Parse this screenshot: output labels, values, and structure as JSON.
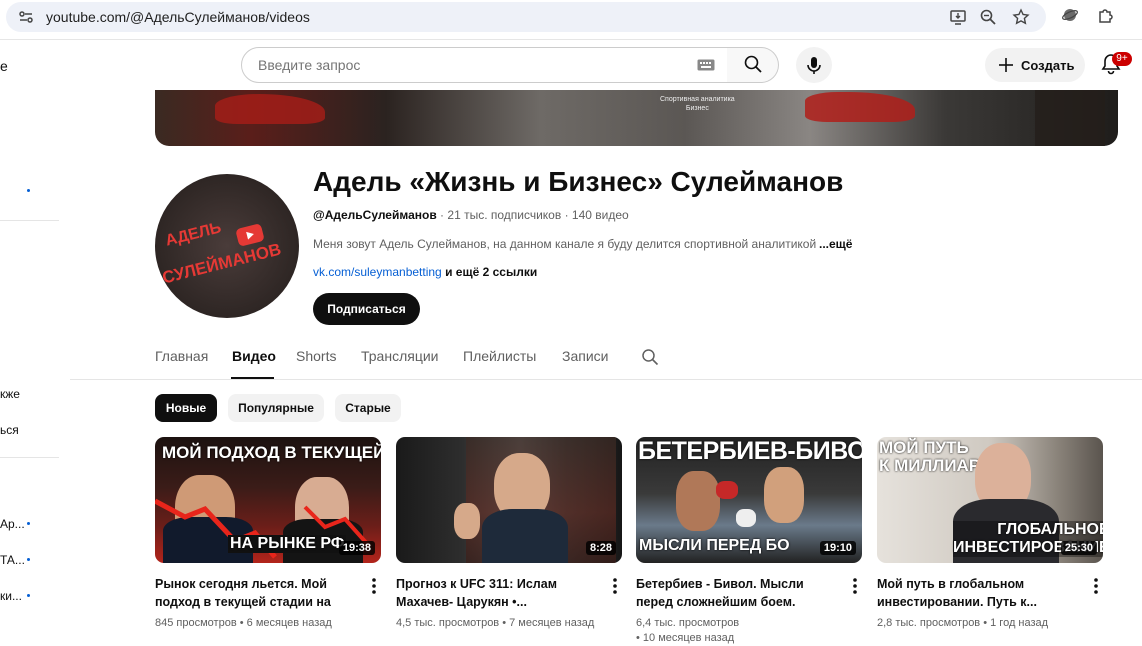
{
  "browser": {
    "url": "youtube.com/@АдельСулейманов/videos"
  },
  "sidebar_fragments": [
    {
      "text": "е"
    },
    {
      "text": "кже"
    },
    {
      "text": "ься"
    },
    {
      "text": "Ар..."
    },
    {
      "text": "ТА..."
    },
    {
      "text": "ки..."
    }
  ],
  "header": {
    "search_placeholder": "Введите запрос",
    "create_label": "Создать",
    "notifications_badge": "9+"
  },
  "banner": {
    "text": "Спортивная аналитика\nБизнес"
  },
  "channel": {
    "avatar_line1": "АДЕЛЬ",
    "avatar_line2": "СУЛЕЙМАНОВ",
    "title": "Адель «Жизнь и Бизнес» Сулейманов",
    "handle": "@АдельСулейманов",
    "subscribers": "21 тыс. подписчиков",
    "videos_count": "140 видео",
    "description": "Меня зовут Адель Сулейманов, на данном канале я буду делится спортивной аналитикой",
    "description_more": "...ещё",
    "link": "vk.com/suleymanbetting",
    "links_more": "и ещё 2 ссылки",
    "subscribe_label": "Подписаться"
  },
  "tabs": [
    {
      "label": "Главная",
      "active": false
    },
    {
      "label": "Видео",
      "active": true
    },
    {
      "label": "Shorts",
      "active": false
    },
    {
      "label": "Трансляции",
      "active": false
    },
    {
      "label": "Плейлисты",
      "active": false
    },
    {
      "label": "Записи",
      "active": false
    }
  ],
  "chips": [
    {
      "label": "Новые",
      "active": true
    },
    {
      "label": "Популярные",
      "active": false
    },
    {
      "label": "Старые",
      "active": false
    }
  ],
  "videos": [
    {
      "thumb_text_top": "МОЙ ПОДХОД В ТЕКУЩЕЙ СТАДИИ",
      "thumb_text_bottom": "НА РЫНКЕ РФ",
      "duration": "19:38",
      "title": "Рынок сегодня льется. Мой подход в текущей стадии на РФ...",
      "views": "845 просмотров",
      "age": "6 месяцев назад"
    },
    {
      "thumb_text_top": "",
      "thumb_text_bottom": "",
      "duration": "8:28",
      "title": "Прогноз к UFC 311: Ислам Махачев- Царукян •...",
      "views": "4,5 тыс. просмотров",
      "age": "7 месяцев назад"
    },
    {
      "thumb_text_top": "БЕТЕРБИЕВ-БИВОЛ",
      "thumb_text_bottom": "МЫСЛИ ПЕРЕД БО",
      "duration": "19:10",
      "title": "Бетербиев - Бивол. Мысли перед сложнейшим боем. Адель...",
      "views": "6,4 тыс. просмотров",
      "age": "10 месяцев назад"
    },
    {
      "thumb_text_top": "МОЙ ПУТЬ\nК МИЛЛИАРДУ",
      "thumb_text_bottom": "ГЛОБАЛЬНОЕ\nИНВЕСТИРОВАНИЕ",
      "duration": "25:30",
      "title": "Мой путь в глобальном инвестировании. Путь к...",
      "views": "2,8 тыс. просмотров",
      "age": "1 год назад"
    }
  ],
  "colors": {
    "accent_red": "#ff0000",
    "link_blue": "#065fd4",
    "text_primary": "#0f0f0f",
    "text_secondary": "#606060"
  }
}
